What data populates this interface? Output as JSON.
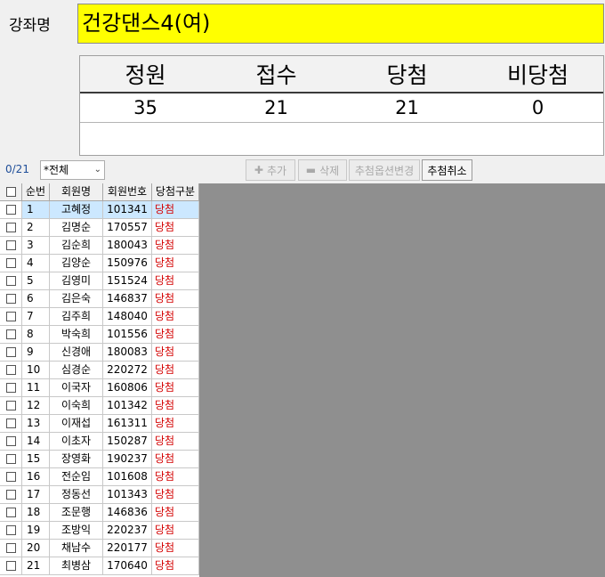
{
  "course": {
    "label": "강좌명",
    "value": "건강댄스4(여)"
  },
  "summary": {
    "headers": [
      "정원",
      "접수",
      "당첨",
      "비당첨"
    ],
    "values": [
      "35",
      "21",
      "21",
      "0"
    ]
  },
  "toolbar": {
    "count": "0/21",
    "filter_value": "*전체",
    "add_label": "추가",
    "delete_label": "삭제",
    "change_option_label": "추첨옵션변경",
    "cancel_draw_label": "추첨취소"
  },
  "grid": {
    "columns": [
      "순번",
      "회원명",
      "회원번호",
      "당첨구분"
    ],
    "rows": [
      {
        "no": "1",
        "name": "고혜정",
        "id": "101341",
        "status": "당첨"
      },
      {
        "no": "2",
        "name": "김명순",
        "id": "170557",
        "status": "당첨"
      },
      {
        "no": "3",
        "name": "김순희",
        "id": "180043",
        "status": "당첨"
      },
      {
        "no": "4",
        "name": "김양순",
        "id": "150976",
        "status": "당첨"
      },
      {
        "no": "5",
        "name": "김영미",
        "id": "151524",
        "status": "당첨"
      },
      {
        "no": "6",
        "name": "김은숙",
        "id": "146837",
        "status": "당첨"
      },
      {
        "no": "7",
        "name": "김주희",
        "id": "148040",
        "status": "당첨"
      },
      {
        "no": "8",
        "name": "박숙희",
        "id": "101556",
        "status": "당첨"
      },
      {
        "no": "9",
        "name": "신경애",
        "id": "180083",
        "status": "당첨"
      },
      {
        "no": "10",
        "name": "심경순",
        "id": "220272",
        "status": "당첨"
      },
      {
        "no": "11",
        "name": "이국자",
        "id": "160806",
        "status": "당첨"
      },
      {
        "no": "12",
        "name": "이숙희",
        "id": "101342",
        "status": "당첨"
      },
      {
        "no": "13",
        "name": "이재섭",
        "id": "161311",
        "status": "당첨"
      },
      {
        "no": "14",
        "name": "이초자",
        "id": "150287",
        "status": "당첨"
      },
      {
        "no": "15",
        "name": "장영화",
        "id": "190237",
        "status": "당첨"
      },
      {
        "no": "16",
        "name": "전순임",
        "id": "101608",
        "status": "당첨"
      },
      {
        "no": "17",
        "name": "정동선",
        "id": "101343",
        "status": "당첨"
      },
      {
        "no": "18",
        "name": "조문행",
        "id": "146836",
        "status": "당첨"
      },
      {
        "no": "19",
        "name": "조방익",
        "id": "220237",
        "status": "당첨"
      },
      {
        "no": "20",
        "name": "채남수",
        "id": "220177",
        "status": "당첨"
      },
      {
        "no": "21",
        "name": "최병삼",
        "id": "170640",
        "status": "당첨"
      }
    ]
  },
  "colors": {
    "title_bg": "#ffff00",
    "win_text": "#d40000",
    "selected_row": "#cce8ff",
    "empty_area": "#8f8f8f"
  }
}
